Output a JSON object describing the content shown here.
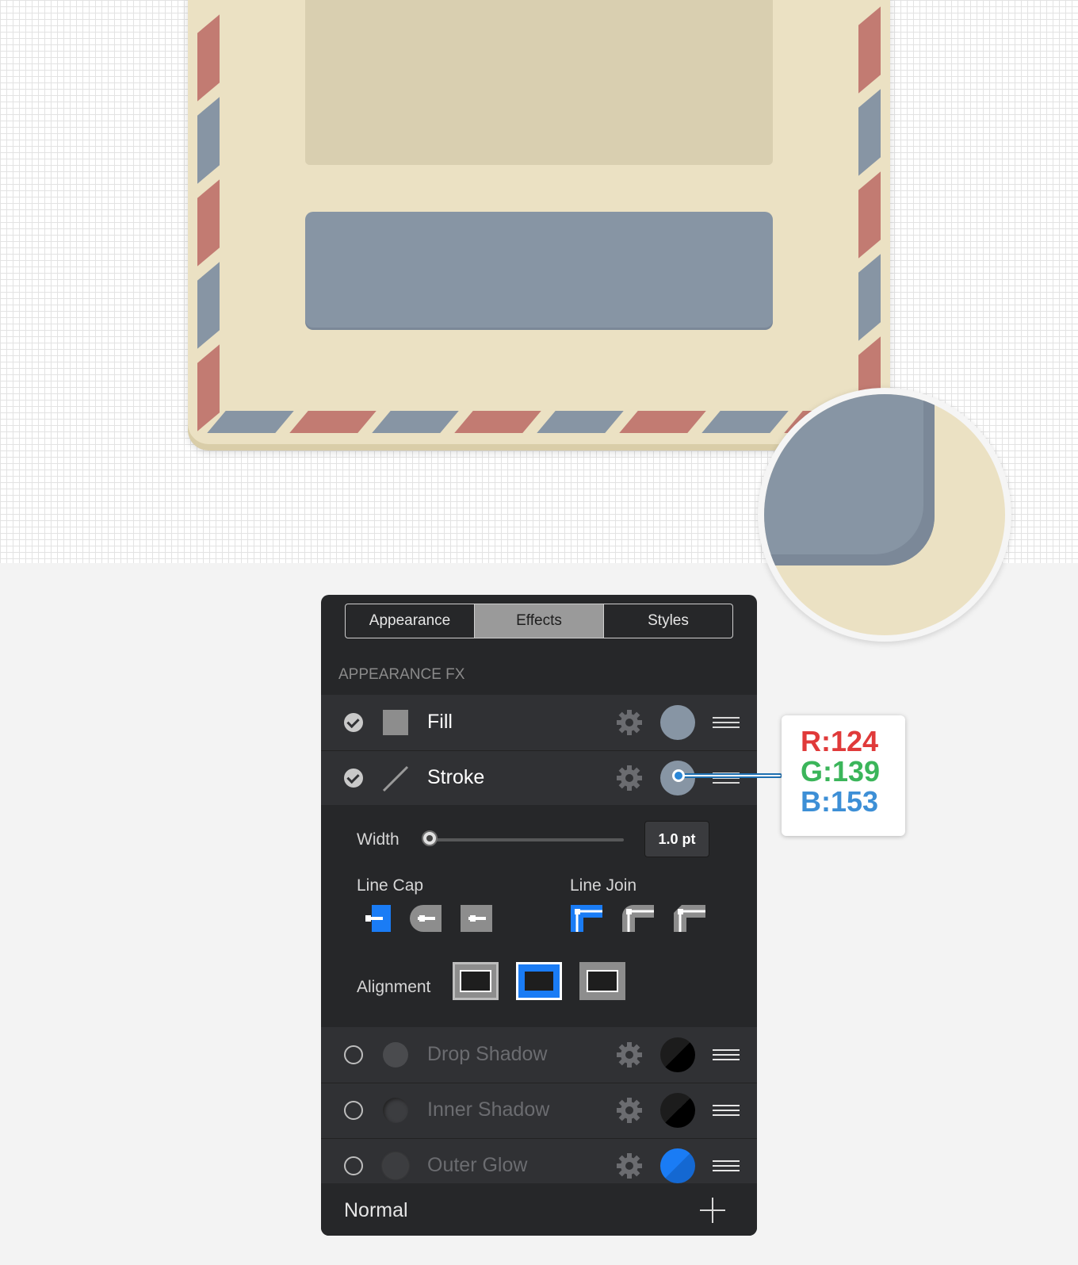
{
  "tabs": [
    {
      "label": "Appearance",
      "active": false
    },
    {
      "label": "Effects",
      "active": true
    },
    {
      "label": "Styles",
      "active": false
    }
  ],
  "section_header": "APPEARANCE FX",
  "rows": [
    {
      "label": "Fill",
      "enabled": true,
      "swatch_color": "#8795a4"
    },
    {
      "label": "Stroke",
      "enabled": true,
      "swatch_color": "#8795a4"
    }
  ],
  "stroke_options": {
    "width_label": "Width",
    "width_value": "1.0 pt",
    "line_cap_label": "Line Cap",
    "line_join_label": "Line Join",
    "alignment_label": "Alignment",
    "selected_cap": "butt",
    "selected_join": "miter",
    "selected_alignment": "center"
  },
  "effects": [
    {
      "label": "Drop Shadow",
      "enabled": false,
      "swatch_color": "#000000"
    },
    {
      "label": "Inner Shadow",
      "enabled": false,
      "swatch_color": "#000000"
    },
    {
      "label": "Outer Glow",
      "enabled": false,
      "swatch_color": "#1a7cf5"
    }
  ],
  "footer": {
    "blend_mode": "Normal"
  },
  "color_callout": {
    "r": "R:124",
    "g": "G:139",
    "b": "B:153",
    "r_color": "#e03a3a",
    "g_color": "#3bb55a",
    "b_color": "#3d8fd6"
  },
  "colors": {
    "accent": "#1a7cf5",
    "envelope": "#ebe1c3",
    "stripe_red": "#c27b72",
    "stripe_blue": "#8795a4"
  }
}
